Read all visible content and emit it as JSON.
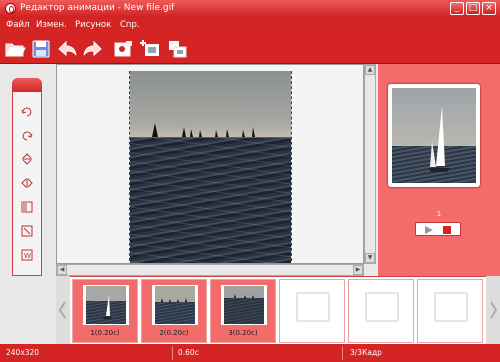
{
  "window": {
    "title": "Редактор анимации - New file.gif",
    "controls": [
      "_",
      "□",
      "×"
    ]
  },
  "menu": [
    "Файл",
    "Измен.",
    "Рисунок",
    "Спр."
  ],
  "toolbar": [
    {
      "icon": "open-folder-icon"
    },
    {
      "icon": "save-icon"
    },
    {
      "icon": "undo-icon"
    },
    {
      "icon": "redo-icon"
    },
    {
      "icon": "image-settings-icon"
    },
    {
      "icon": "add-frame-icon"
    },
    {
      "icon": "insert-frame-icon"
    }
  ],
  "tools": [
    "rotate-left-icon",
    "rotate-right-icon",
    "flip-vertical-icon",
    "flip-horizontal-icon",
    "crop-icon",
    "resize-icon",
    "text-icon"
  ],
  "preview": {
    "frame_number": "1"
  },
  "frames": [
    {
      "label": "1(0.20с)",
      "filled": true,
      "small": false
    },
    {
      "label": "2(0.20с)",
      "filled": true,
      "small": true
    },
    {
      "label": "3(0.20с)",
      "filled": true,
      "small": false
    },
    {
      "label": "",
      "filled": false
    },
    {
      "label": "",
      "filled": false
    },
    {
      "label": "",
      "filled": false
    }
  ],
  "status": {
    "size": "240x320",
    "duration": "0.60с",
    "frame": "3/3Кадр"
  },
  "colors": {
    "accent": "#d42424",
    "panel": "#f36b6b"
  }
}
